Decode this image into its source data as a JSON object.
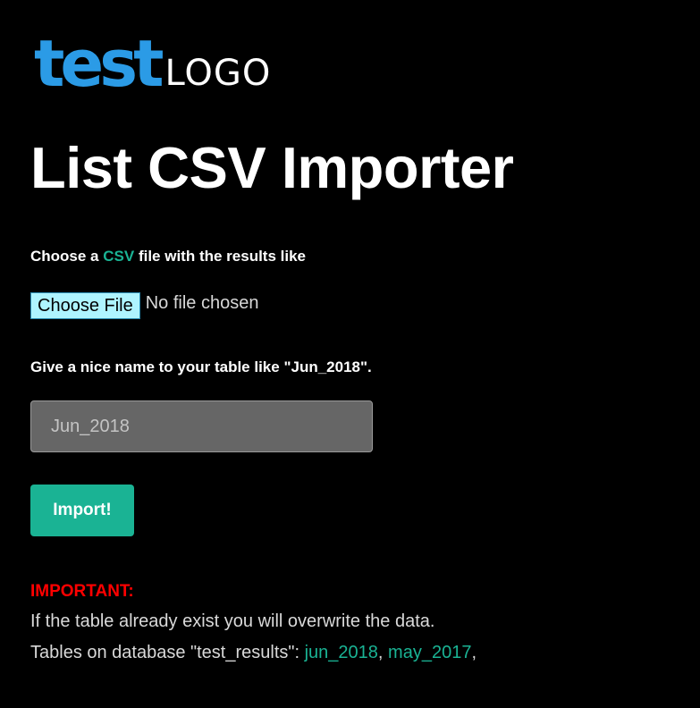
{
  "logo": {
    "brand": "test",
    "word": "LOGO",
    "brand_color": "#2b9be6"
  },
  "page_title": "List CSV Importer",
  "csv_prompt": {
    "prefix": "Choose a ",
    "highlight": "CSV",
    "suffix": " file with the results like"
  },
  "file_input": {
    "button_label": "Choose File",
    "status": "No file chosen"
  },
  "name_prompt": "Give a nice name to your table like \"Jun_2018\".",
  "table_name_input": {
    "placeholder": "Jun_2018",
    "value": ""
  },
  "import_button_label": "Import!",
  "warning": {
    "label": "IMPORTANT:",
    "message": "If the table already exist you will overwrite the data."
  },
  "tables_info": {
    "prefix": "Tables on database \"test_results\": ",
    "tables": [
      "jun_2018",
      "may_2017"
    ],
    "separator": ","
  },
  "colors": {
    "background": "#000000",
    "accent": "#1ab394",
    "warning": "#ff0000",
    "file_button_bg": "#aef4ff",
    "input_bg": "#666666"
  }
}
